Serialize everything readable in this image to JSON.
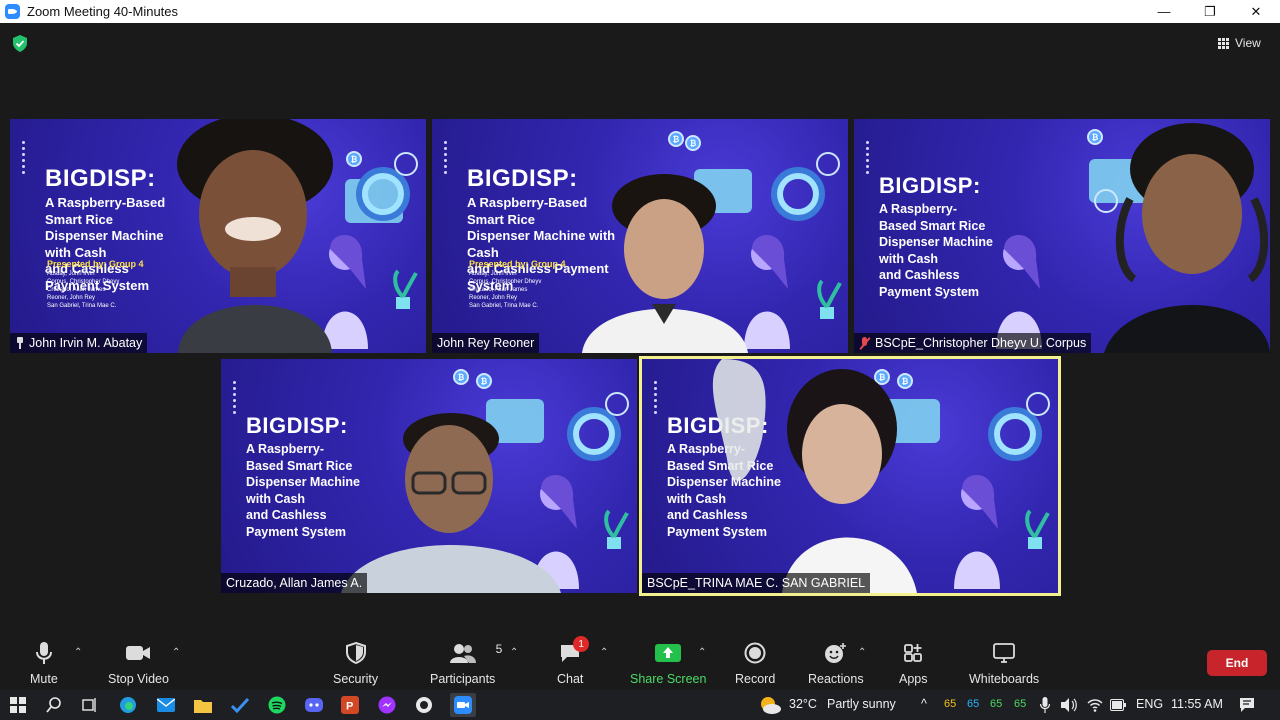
{
  "window": {
    "title": "Zoom Meeting 40-Minutes",
    "min_glyph": "—",
    "max_glyph": "❐",
    "close_glyph": "✕"
  },
  "top": {
    "view_label": "View",
    "security_shield_color": "#23c16b"
  },
  "slide": {
    "title": "BIGDISP:",
    "presented_by": "Presented by: Group 4",
    "names": "Abatay, John Irvin\nCorpus, Christopher Dheyv\nCruzado, Allan James\nReoner, John Rey\nSan Gabriel, Trina Mae C.",
    "sub_wide": "A Raspberry-Based Smart Rice\nDispenser Machine with Cash\nand Cashless Payment System",
    "sub_tall": "A Raspberry-\nBased Smart Rice\nDispenser Machine\nwith Cash\nand Cashless\nPayment System",
    "coin_glyph": "₿"
  },
  "participants": [
    {
      "name": "John Irvin M. Abatay",
      "icon": "pin-icon"
    },
    {
      "name": "John Rey Reoner",
      "icon": ""
    },
    {
      "name": "BSCpE_Christopher Dheyv U. Corpus",
      "icon": "mic-muted-icon"
    },
    {
      "name": "Cruzado, Allan James A.",
      "icon": ""
    },
    {
      "name": "BSCpE_TRINA MAE C. SAN GABRIEL",
      "icon": "",
      "active_speaker": true
    }
  ],
  "toolbar": {
    "mute": "Mute",
    "stop_video": "Stop Video",
    "security": "Security",
    "participants": "Participants",
    "participants_count": "5",
    "chat": "Chat",
    "chat_badge": "1",
    "share_screen": "Share Screen",
    "record": "Record",
    "reactions": "Reactions",
    "apps": "Apps",
    "whiteboards": "Whiteboards",
    "end": "End",
    "caret": "⌃"
  },
  "taskbar": {
    "weather_temp": "32°C",
    "weather_text": "Partly sunny",
    "tray_caret": "^",
    "gpu_values": [
      "65",
      "65",
      "65",
      "65"
    ],
    "language": "ENG",
    "time": "11:55 AM"
  },
  "colors": {
    "accent_share": "#23c14b",
    "end_button": "#c7252b",
    "active_border": "#f3f08d"
  }
}
